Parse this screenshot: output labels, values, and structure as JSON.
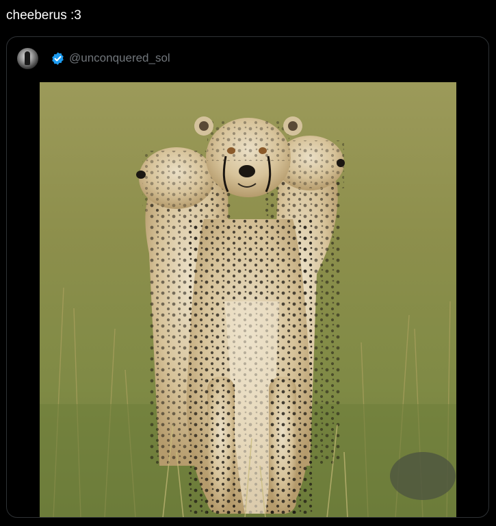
{
  "post": {
    "text": "cheeberus :3"
  },
  "quoted": {
    "handle": "@unconquered_sol",
    "verified": true,
    "avatar_icon": "avatar-cheetah-photo",
    "verified_icon": "verified-badge-icon",
    "image_icon": "cheetah-three-heads-photo"
  },
  "colors": {
    "background": "#000000",
    "text_primary": "#ffffff",
    "text_secondary": "#71767b",
    "border": "#2f3336",
    "verified_blue": "#1d9bf0"
  }
}
